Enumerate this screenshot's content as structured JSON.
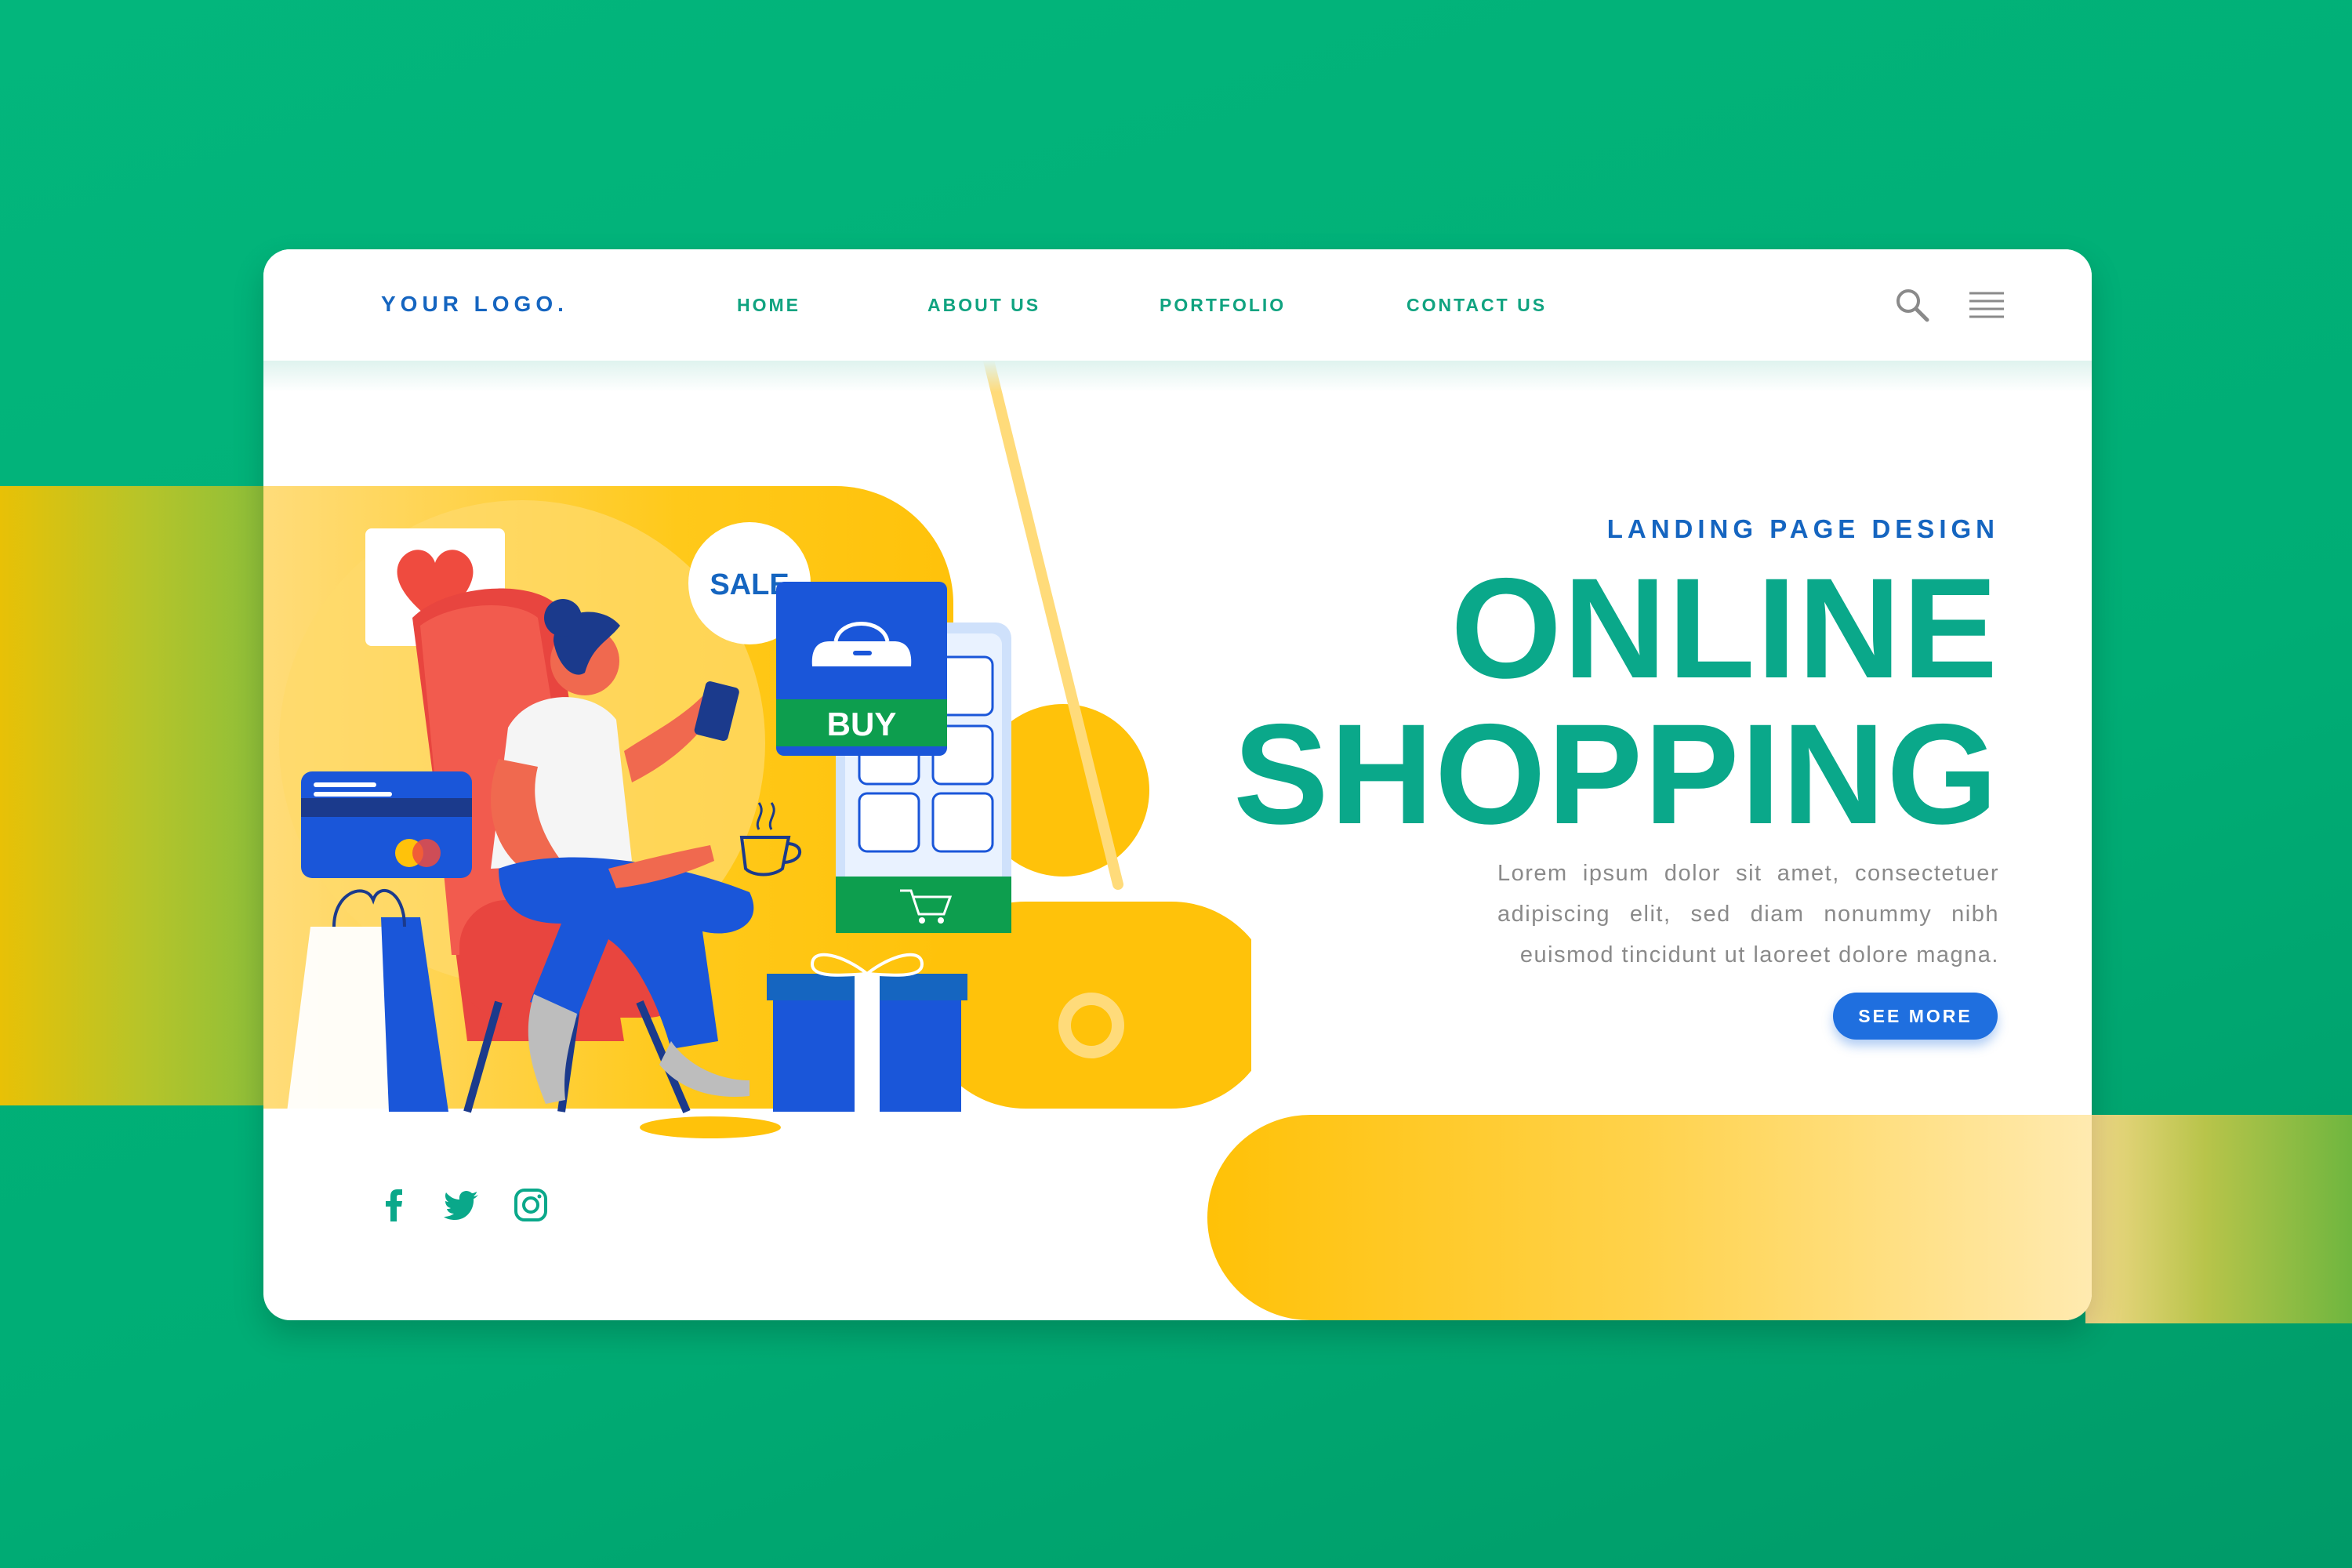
{
  "nav": {
    "logo": "YOUR LOGO.",
    "links": [
      "HOME",
      "ABOUT US",
      "PORTFOLIO",
      "CONTACT US"
    ],
    "icons": [
      "search-icon",
      "menu-icon"
    ]
  },
  "hero": {
    "subtitle": "LANDING PAGE DESIGN",
    "title_line1": "ONLINE",
    "title_line2": "SHOPPING",
    "description": "Lorem ipsum dolor sit amet, consectetuer adipiscing elit, sed diam nonummy nibh euismod tincidunt ut laoreet dolore magna.",
    "cta_label": "SEE MORE"
  },
  "illustration": {
    "sale_badge": "SALE",
    "buy_label": "BUY",
    "percent_symbol": "%"
  },
  "social": {
    "icons": [
      "facebook-icon",
      "twitter-icon",
      "instagram-icon"
    ]
  },
  "colors": {
    "background": "#00ad75",
    "accent_blue": "#1565c0",
    "accent_green": "#0aa88a",
    "accent_yellow": "#ffc20a",
    "cta_blue": "#1f6fdf"
  }
}
